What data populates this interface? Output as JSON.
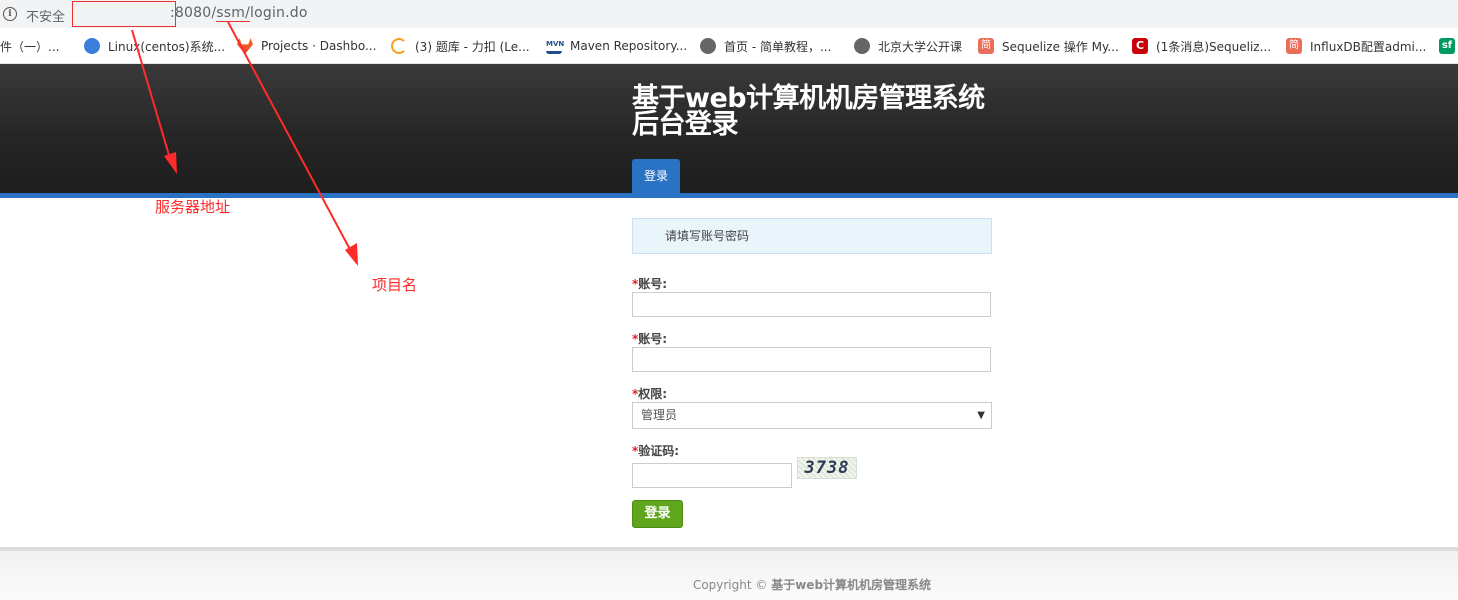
{
  "browser": {
    "insecure_label": "不安全",
    "url_port": ":8080/",
    "url_project": "ssm/",
    "url_path": "login.do",
    "info_icon": "i"
  },
  "bookmarks": [
    {
      "label": "件（一）...",
      "icon": "none",
      "color": "#ffffff"
    },
    {
      "label": "Linux(centos)系统...",
      "icon": "globe-blue-icon",
      "color": "#3b7ddd"
    },
    {
      "label": "Projects · Dashbo...",
      "icon": "gitlab-icon",
      "color": "#e24329"
    },
    {
      "label": "(3) 题库 - 力扣 (Le...",
      "icon": "leetcode-icon",
      "color": "#f89f1b"
    },
    {
      "label": "Maven Repository...",
      "icon": "maven-icon",
      "color": "#1f4e8c"
    },
    {
      "label": "首页 - 简单教程，...",
      "icon": "globe-icon",
      "color": "#555555"
    },
    {
      "label": "北京大学公开课",
      "icon": "globe-icon",
      "color": "#555555"
    },
    {
      "label": "Sequelize 操作 My...",
      "icon": "jianshu-icon",
      "color": "#ea6f5a"
    },
    {
      "label": "(1条消息)Sequeliz...",
      "icon": "csdn-icon",
      "color": "#c9000a"
    },
    {
      "label": "InfluxDB配置admi...",
      "icon": "jianshu-icon",
      "color": "#ea6f5a"
    },
    {
      "label": "sf",
      "icon": "segmentfault-icon",
      "color": "#009a61"
    }
  ],
  "header": {
    "title": "基于web计算机机房管理系统后台登录",
    "nav_login_tab": "登录"
  },
  "annotations": {
    "server_address": "服务器地址",
    "project_name": "项目名"
  },
  "form": {
    "notice": "请填写账号密码",
    "required_mark": "*",
    "account_label": "账号:",
    "password_label": "账号:",
    "role_label": "权限:",
    "role_selected": "管理员",
    "captcha_label": "验证码:",
    "captcha_text": "3738",
    "submit_label": "登录"
  },
  "footer": {
    "copyright_prefix": "Copyright ©",
    "copyright_name": "基于web计算机机房管理系统"
  },
  "colors": {
    "accent": "#2a72c4",
    "login_button": "#5fa51d",
    "annotation": "#ff2a2a"
  }
}
